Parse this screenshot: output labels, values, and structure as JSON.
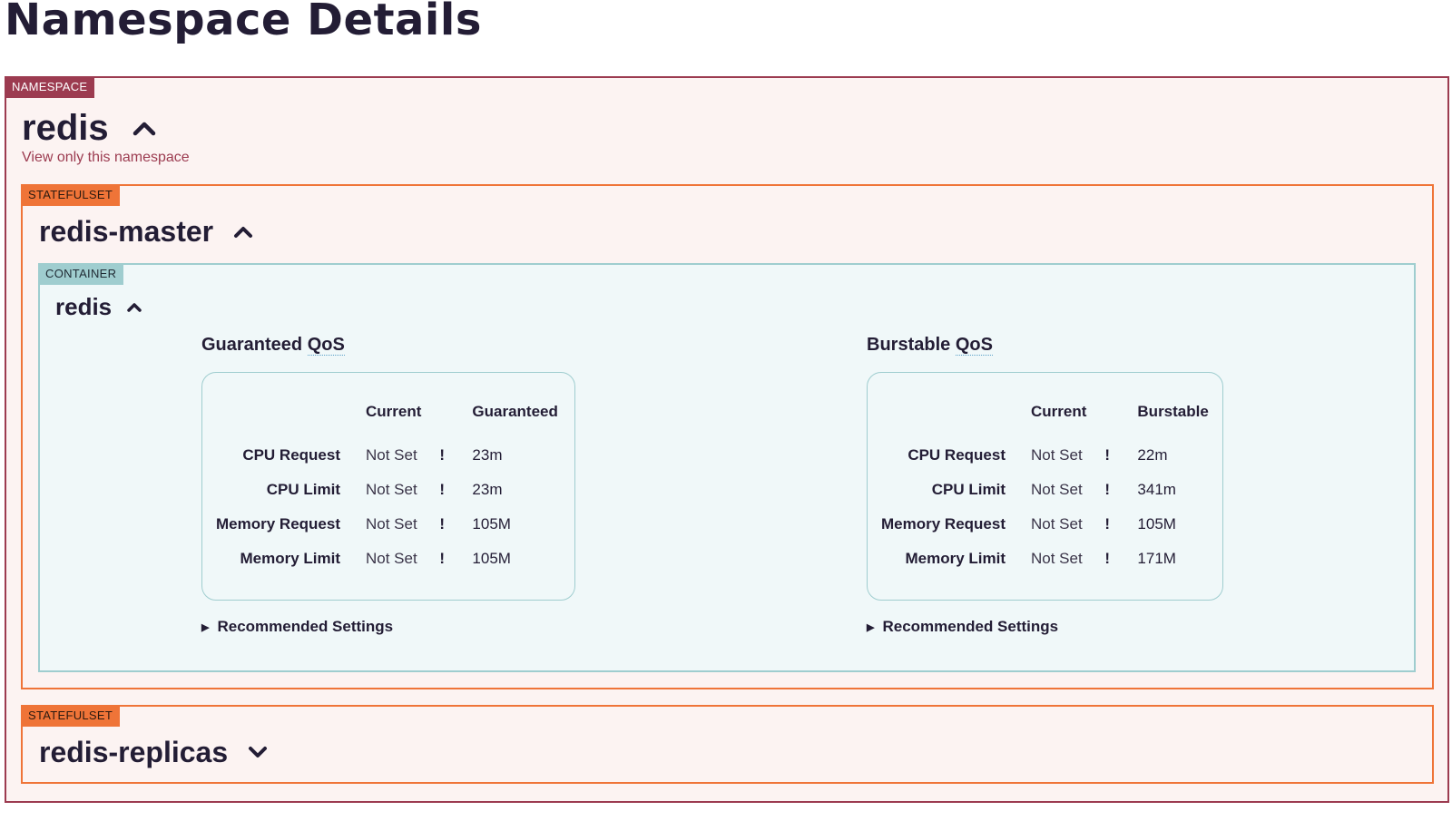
{
  "page": {
    "title": "Namespace Details"
  },
  "namespace": {
    "badge": "NAMESPACE",
    "name": "redis",
    "view_link": "View only this namespace"
  },
  "statefulsets": [
    {
      "badge": "STATEFULSET",
      "name": "redis-master",
      "expanded": true,
      "container": {
        "badge": "CONTAINER",
        "name": "redis",
        "qos": [
          {
            "title_prefix": "Guaranteed ",
            "title_abbr": "QoS",
            "columns": [
              "Current",
              "Guaranteed"
            ],
            "rows": [
              {
                "label": "CPU Request",
                "current": "Not Set",
                "flag": "!",
                "value": "23m"
              },
              {
                "label": "CPU Limit",
                "current": "Not Set",
                "flag": "!",
                "value": "23m"
              },
              {
                "label": "Memory Request",
                "current": "Not Set",
                "flag": "!",
                "value": "105M"
              },
              {
                "label": "Memory Limit",
                "current": "Not Set",
                "flag": "!",
                "value": "105M"
              }
            ],
            "recommended": "Recommended Settings"
          },
          {
            "title_prefix": "Burstable ",
            "title_abbr": "QoS",
            "columns": [
              "Current",
              "Burstable"
            ],
            "rows": [
              {
                "label": "CPU Request",
                "current": "Not Set",
                "flag": "!",
                "value": "22m"
              },
              {
                "label": "CPU Limit",
                "current": "Not Set",
                "flag": "!",
                "value": "341m"
              },
              {
                "label": "Memory Request",
                "current": "Not Set",
                "flag": "!",
                "value": "105M"
              },
              {
                "label": "Memory Limit",
                "current": "Not Set",
                "flag": "!",
                "value": "171M"
              }
            ],
            "recommended": "Recommended Settings"
          }
        ]
      }
    },
    {
      "badge": "STATEFULSET",
      "name": "redis-replicas",
      "expanded": false
    }
  ],
  "icons": {
    "collapse": "chevron-up-icon",
    "expand": "chevron-down-icon",
    "disclosure": "triangle-right-icon",
    "warning": "exclamation-icon"
  },
  "colors": {
    "namespace": "#9c3b50",
    "statefulset": "#ef7438",
    "container": "#9fcdcf",
    "warning": "#b0253c"
  }
}
